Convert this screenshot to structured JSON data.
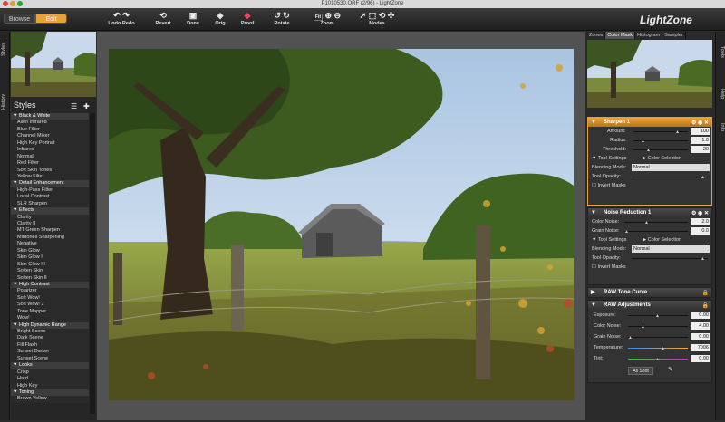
{
  "window": {
    "title": "P1010530.ORF (2/96) - LightZone"
  },
  "modes": {
    "browse": "Browse",
    "edit": "Edit"
  },
  "toolbar": {
    "undo_redo": "Undo Redo",
    "revert": "Revert",
    "done": "Done",
    "orig": "Orig",
    "proof": "Proof",
    "rotate": "Rotate",
    "zoom": "Zoom",
    "zoom_fit": "Fit",
    "modes": "Modes",
    "brand": "LightZone"
  },
  "left_tabs": {
    "styles": "Styles",
    "history": "History"
  },
  "right_tabs": {
    "tools": "Tools",
    "help": "Help",
    "info": "Info"
  },
  "styles": {
    "title": "Styles",
    "items": [
      {
        "label": "Black & White",
        "header": true
      },
      {
        "label": "Alien Infrared"
      },
      {
        "label": "Blue Filter"
      },
      {
        "label": "Channel Mixer"
      },
      {
        "label": "High Key Portrait"
      },
      {
        "label": "Infrared"
      },
      {
        "label": "Normal"
      },
      {
        "label": "Red Filter"
      },
      {
        "label": "Soft Skin Tones"
      },
      {
        "label": "Yellow Filter"
      },
      {
        "label": "Detail Enhancement",
        "header": true
      },
      {
        "label": "High-Pass Filter"
      },
      {
        "label": "Local Contrast"
      },
      {
        "label": "SLR Sharpen"
      },
      {
        "label": "Effects",
        "header": true
      },
      {
        "label": "Clarity"
      },
      {
        "label": "Clarity II"
      },
      {
        "label": "MT Green Sharpen"
      },
      {
        "label": "Midtones Sharpening"
      },
      {
        "label": "Negative"
      },
      {
        "label": "Skin Glow"
      },
      {
        "label": "Skin Glow II"
      },
      {
        "label": "Skin Glow III"
      },
      {
        "label": "Soften Skin"
      },
      {
        "label": "Soften Skin II"
      },
      {
        "label": "High Contrast",
        "header": true
      },
      {
        "label": "Polarizer"
      },
      {
        "label": "Soft Wow!"
      },
      {
        "label": "Soft Wow! 2"
      },
      {
        "label": "Tone Mapper"
      },
      {
        "label": "Wow!"
      },
      {
        "label": "High Dynamic Range",
        "header": true
      },
      {
        "label": "Bright Scene"
      },
      {
        "label": "Dark Scene"
      },
      {
        "label": "Fill Flash"
      },
      {
        "label": "Sunset Darker"
      },
      {
        "label": "Sunset Scene"
      },
      {
        "label": "Looks",
        "header": true
      },
      {
        "label": "Crisp"
      },
      {
        "label": "Hard"
      },
      {
        "label": "High Key"
      },
      {
        "label": "Toning",
        "header": true
      },
      {
        "label": "Brown Yellow"
      }
    ]
  },
  "panel_tabs": [
    "Zones",
    "Color Mask",
    "Histogram",
    "Sampler"
  ],
  "sharpen": {
    "title": "Sharpen 1",
    "amount_label": "Amount:",
    "amount": "100",
    "radius_label": "Radius:",
    "radius": "1.0",
    "threshold_label": "Threshold:",
    "threshold": "20",
    "tool_settings": "Tool Settings",
    "color_selection": "Color Selection",
    "blending_label": "Blending Mode:",
    "blending": "Normal",
    "opacity_label": "Tool Opacity:",
    "invert": "Invert Masks"
  },
  "noise": {
    "title": "Noise Reduction 1",
    "color_noise_label": "Color Noise:",
    "color_noise": "2.0",
    "grain_noise_label": "Grain Noise:",
    "grain_noise": "0.0",
    "tool_settings": "Tool Settings",
    "color_selection": "Color Selection",
    "blending_label": "Blending Mode:",
    "blending": "Normal",
    "opacity_label": "Tool Opacity:",
    "invert": "Invert Masks"
  },
  "tone_curve": {
    "title": "RAW Tone Curve"
  },
  "raw_adj": {
    "title": "RAW Adjustments",
    "exposure_label": "Exposure:",
    "exposure": "0.00",
    "color_noise_label": "Color Noise:",
    "color_noise": "4.00",
    "grain_noise_label": "Grain Noise:",
    "grain_noise": "0.00",
    "temperature_label": "Temperature:",
    "temperature": "7006",
    "tint_label": "Tint:",
    "tint": "0.00",
    "as_shot": "As Shot"
  },
  "colors": {
    "accent": "#e8a23a",
    "sharpen_border": "#e8a23a"
  }
}
